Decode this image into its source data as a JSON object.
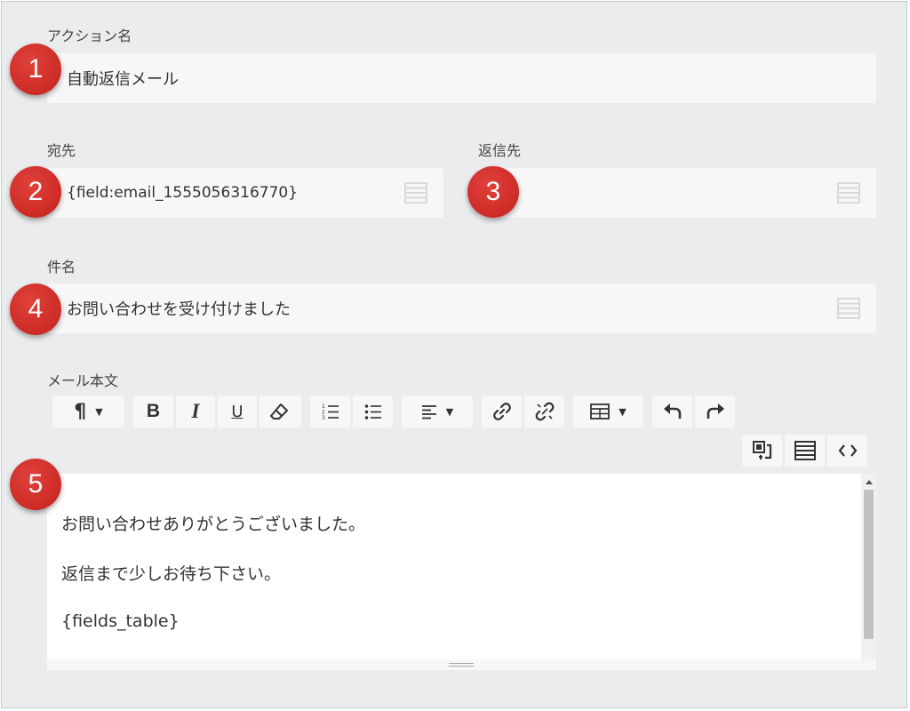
{
  "action_name": {
    "label": "アクション名",
    "value": "自動返信メール"
  },
  "to": {
    "label": "宛先",
    "value": "{field:email_1555056316770}"
  },
  "reply_to": {
    "label": "返信先",
    "value": ""
  },
  "subject": {
    "label": "件名",
    "value": "お問い合わせを受け付けました"
  },
  "body": {
    "label": "メール本文",
    "lines": [
      "お問い合わせありがとうございました。",
      "返信まで少しお待ち下さい。",
      "{fields_table}"
    ]
  },
  "badges": [
    "1",
    "2",
    "3",
    "4",
    "5"
  ],
  "toolbar": {
    "paragraph_glyph": "¶",
    "bold_glyph": "B",
    "italic_glyph": "I",
    "underline_glyph": "U"
  },
  "colors": {
    "badge": "#cc2b26",
    "background": "#ebecee",
    "field": "#f7f7f8"
  }
}
